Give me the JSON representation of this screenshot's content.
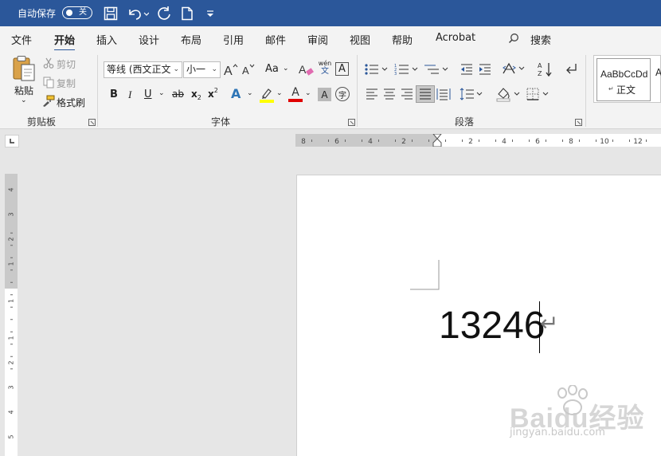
{
  "titlebar": {
    "autosave_label": "自动保存",
    "toggle_state": "关"
  },
  "tabs": [
    "文件",
    "开始",
    "插入",
    "设计",
    "布局",
    "引用",
    "邮件",
    "审阅",
    "视图",
    "帮助",
    "Acrobat",
    "搜索"
  ],
  "active_tab": "开始",
  "clipboard": {
    "paste": "粘贴",
    "cut": "剪切",
    "copy": "复制",
    "format_painter": "格式刷",
    "group_label": "剪贴板"
  },
  "font": {
    "font_name": "等线 (西文正文",
    "font_size": "小一",
    "change_case": "Aa",
    "phonetic_top": "wén",
    "phonetic_bottom": "文",
    "border_char": "A",
    "bold": "B",
    "italic": "I",
    "underline": "U",
    "strike": "ab",
    "subscript": "x",
    "superscript": "x",
    "text_effect": "A",
    "font_color": "A",
    "shading": "A",
    "enclose": "字",
    "group_label": "字体"
  },
  "paragraph": {
    "group_label": "段落"
  },
  "styles": {
    "card_preview": "AaBbCcDd",
    "card_name": "正文",
    "next_preview": "A"
  },
  "ruler": {
    "h_left": [
      "8",
      "6",
      "4",
      "2"
    ],
    "h_right": [
      "2",
      "4",
      "6",
      "8",
      "10",
      "12"
    ],
    "v_top": [
      "4",
      "3",
      "2",
      "1"
    ],
    "v_bottom": [
      "1",
      "1",
      "2",
      "3",
      "4",
      "5",
      "6"
    ]
  },
  "document": {
    "text": "13246",
    "paragraph_mark": "↵"
  },
  "watermark": {
    "brand": "Baidu经验",
    "url": "jingyan.baidu.com"
  },
  "colors": {
    "titlebar": "#2b579a",
    "ribbon": "#f3f3f3",
    "highlight": "#ffff00",
    "font_color": "#e00000",
    "text_effect": "#2e75b6"
  }
}
